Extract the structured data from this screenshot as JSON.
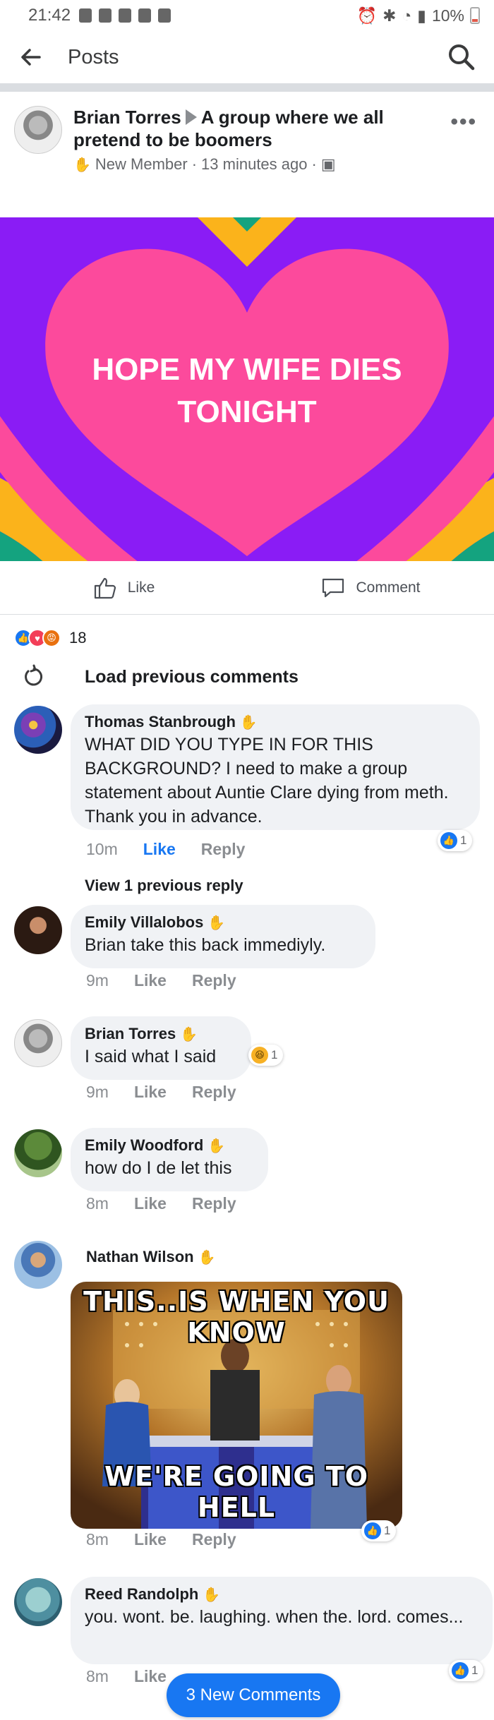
{
  "status_bar": {
    "time": "21:42",
    "battery": "10%"
  },
  "header": {
    "title": "Posts"
  },
  "post": {
    "author": "Brian Torres",
    "group": "A group where we all pretend to be boomers",
    "badge": "New Member",
    "time": "13 minutes ago",
    "sep": "·",
    "background_text_line1": "HOPE MY WIFE DIES",
    "background_text_line2": "TONIGHT",
    "like_label": "Like",
    "comment_label": "Comment",
    "reaction_count": "18",
    "load_previous_label": "Load previous comments",
    "colors": {
      "purple": "#8a1cf5",
      "pink": "#fc4a9c",
      "orange": "#fbb31b",
      "teal": "#14a37f"
    }
  },
  "comments": [
    {
      "name": "Thomas Stanbrough",
      "text": "WHAT DID YOU TYPE IN FOR THIS BACKGROUND? I need to make a group statement about Auntie Clare dying from meth. Thank you in advance.",
      "time": "10m",
      "like": "Like",
      "reply": "Reply",
      "reaction_count": "1"
    },
    {
      "name": "Emily Villalobos",
      "text": "Brian take this back immediyly.",
      "time": "9m",
      "like": "Like",
      "reply": "Reply"
    },
    {
      "name": "Brian Torres",
      "text": "I said what I said",
      "time": "9m",
      "like": "Like",
      "reply": "Reply",
      "reaction_count": "1"
    },
    {
      "name": "Emily Woodford",
      "text": "how do I de let this",
      "time": "8m",
      "like": "Like",
      "reply": "Reply"
    },
    {
      "name": "Nathan Wilson",
      "meme_top": "THIS..IS WHEN YOU KNOW",
      "meme_bottom": "WE'RE GOING TO HELL",
      "time": "8m",
      "like": "Like",
      "reply": "Reply",
      "reaction_count": "1"
    },
    {
      "name": "Reed Randolph",
      "text": "you. wont. be. laughing. when the. lord. comes...",
      "time": "8m",
      "like": "Like",
      "reaction_count": "1"
    }
  ],
  "view_previous_reply": "View 1 previous reply",
  "new_comments_button": "3 New Comments"
}
